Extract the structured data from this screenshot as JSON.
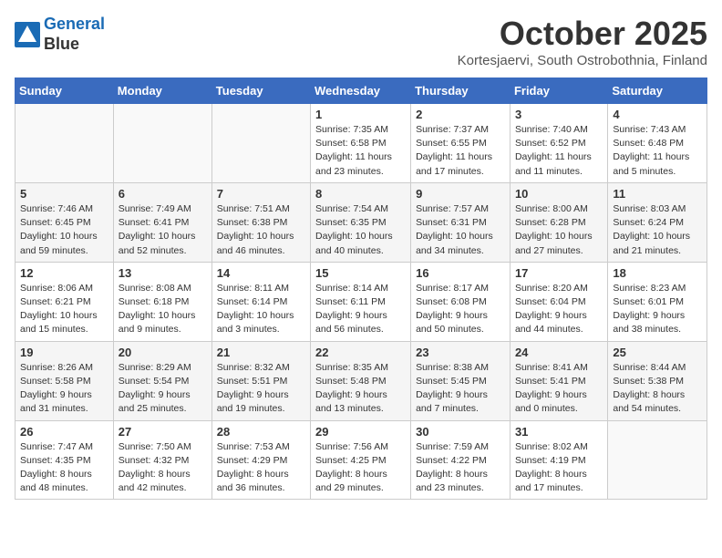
{
  "header": {
    "logo_line1": "General",
    "logo_line2": "Blue",
    "month": "October 2025",
    "location": "Kortesjaervi, South Ostrobothnia, Finland"
  },
  "weekdays": [
    "Sunday",
    "Monday",
    "Tuesday",
    "Wednesday",
    "Thursday",
    "Friday",
    "Saturday"
  ],
  "weeks": [
    [
      {
        "day": "",
        "info": ""
      },
      {
        "day": "",
        "info": ""
      },
      {
        "day": "",
        "info": ""
      },
      {
        "day": "1",
        "info": "Sunrise: 7:35 AM\nSunset: 6:58 PM\nDaylight: 11 hours\nand 23 minutes."
      },
      {
        "day": "2",
        "info": "Sunrise: 7:37 AM\nSunset: 6:55 PM\nDaylight: 11 hours\nand 17 minutes."
      },
      {
        "day": "3",
        "info": "Sunrise: 7:40 AM\nSunset: 6:52 PM\nDaylight: 11 hours\nand 11 minutes."
      },
      {
        "day": "4",
        "info": "Sunrise: 7:43 AM\nSunset: 6:48 PM\nDaylight: 11 hours\nand 5 minutes."
      }
    ],
    [
      {
        "day": "5",
        "info": "Sunrise: 7:46 AM\nSunset: 6:45 PM\nDaylight: 10 hours\nand 59 minutes."
      },
      {
        "day": "6",
        "info": "Sunrise: 7:49 AM\nSunset: 6:41 PM\nDaylight: 10 hours\nand 52 minutes."
      },
      {
        "day": "7",
        "info": "Sunrise: 7:51 AM\nSunset: 6:38 PM\nDaylight: 10 hours\nand 46 minutes."
      },
      {
        "day": "8",
        "info": "Sunrise: 7:54 AM\nSunset: 6:35 PM\nDaylight: 10 hours\nand 40 minutes."
      },
      {
        "day": "9",
        "info": "Sunrise: 7:57 AM\nSunset: 6:31 PM\nDaylight: 10 hours\nand 34 minutes."
      },
      {
        "day": "10",
        "info": "Sunrise: 8:00 AM\nSunset: 6:28 PM\nDaylight: 10 hours\nand 27 minutes."
      },
      {
        "day": "11",
        "info": "Sunrise: 8:03 AM\nSunset: 6:24 PM\nDaylight: 10 hours\nand 21 minutes."
      }
    ],
    [
      {
        "day": "12",
        "info": "Sunrise: 8:06 AM\nSunset: 6:21 PM\nDaylight: 10 hours\nand 15 minutes."
      },
      {
        "day": "13",
        "info": "Sunrise: 8:08 AM\nSunset: 6:18 PM\nDaylight: 10 hours\nand 9 minutes."
      },
      {
        "day": "14",
        "info": "Sunrise: 8:11 AM\nSunset: 6:14 PM\nDaylight: 10 hours\nand 3 minutes."
      },
      {
        "day": "15",
        "info": "Sunrise: 8:14 AM\nSunset: 6:11 PM\nDaylight: 9 hours\nand 56 minutes."
      },
      {
        "day": "16",
        "info": "Sunrise: 8:17 AM\nSunset: 6:08 PM\nDaylight: 9 hours\nand 50 minutes."
      },
      {
        "day": "17",
        "info": "Sunrise: 8:20 AM\nSunset: 6:04 PM\nDaylight: 9 hours\nand 44 minutes."
      },
      {
        "day": "18",
        "info": "Sunrise: 8:23 AM\nSunset: 6:01 PM\nDaylight: 9 hours\nand 38 minutes."
      }
    ],
    [
      {
        "day": "19",
        "info": "Sunrise: 8:26 AM\nSunset: 5:58 PM\nDaylight: 9 hours\nand 31 minutes."
      },
      {
        "day": "20",
        "info": "Sunrise: 8:29 AM\nSunset: 5:54 PM\nDaylight: 9 hours\nand 25 minutes."
      },
      {
        "day": "21",
        "info": "Sunrise: 8:32 AM\nSunset: 5:51 PM\nDaylight: 9 hours\nand 19 minutes."
      },
      {
        "day": "22",
        "info": "Sunrise: 8:35 AM\nSunset: 5:48 PM\nDaylight: 9 hours\nand 13 minutes."
      },
      {
        "day": "23",
        "info": "Sunrise: 8:38 AM\nSunset: 5:45 PM\nDaylight: 9 hours\nand 7 minutes."
      },
      {
        "day": "24",
        "info": "Sunrise: 8:41 AM\nSunset: 5:41 PM\nDaylight: 9 hours\nand 0 minutes."
      },
      {
        "day": "25",
        "info": "Sunrise: 8:44 AM\nSunset: 5:38 PM\nDaylight: 8 hours\nand 54 minutes."
      }
    ],
    [
      {
        "day": "26",
        "info": "Sunrise: 7:47 AM\nSunset: 4:35 PM\nDaylight: 8 hours\nand 48 minutes."
      },
      {
        "day": "27",
        "info": "Sunrise: 7:50 AM\nSunset: 4:32 PM\nDaylight: 8 hours\nand 42 minutes."
      },
      {
        "day": "28",
        "info": "Sunrise: 7:53 AM\nSunset: 4:29 PM\nDaylight: 8 hours\nand 36 minutes."
      },
      {
        "day": "29",
        "info": "Sunrise: 7:56 AM\nSunset: 4:25 PM\nDaylight: 8 hours\nand 29 minutes."
      },
      {
        "day": "30",
        "info": "Sunrise: 7:59 AM\nSunset: 4:22 PM\nDaylight: 8 hours\nand 23 minutes."
      },
      {
        "day": "31",
        "info": "Sunrise: 8:02 AM\nSunset: 4:19 PM\nDaylight: 8 hours\nand 17 minutes."
      },
      {
        "day": "",
        "info": ""
      }
    ]
  ]
}
